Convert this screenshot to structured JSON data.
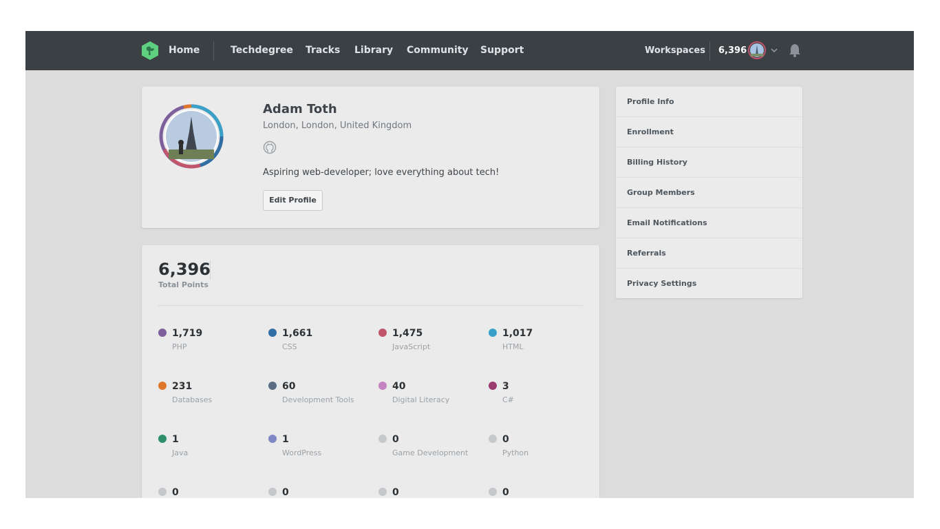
{
  "nav": {
    "home": "Home",
    "techdegree": "Techdegree",
    "tracks": "Tracks",
    "library": "Library",
    "community": "Community",
    "support": "Support",
    "workspaces": "Workspaces",
    "points": "6,396",
    "logo_icon": "treehouse-logo-icon",
    "bell_icon": "bell-icon",
    "chevron_icon": "chevron-down-icon"
  },
  "profile": {
    "name": "Adam Toth",
    "location": "London, London, United Kingdom",
    "github_icon": "github-icon",
    "bio": "Aspiring web-developer; love everything about tech!",
    "edit_button": "Edit Profile"
  },
  "points": {
    "total": "6,396",
    "total_label": "Total Points",
    "topics": [
      {
        "value": "1,719",
        "label": "PHP",
        "color": "#7d5f9c"
      },
      {
        "value": "1,661",
        "label": "CSS",
        "color": "#2f6fa3"
      },
      {
        "value": "1,475",
        "label": "JavaScript",
        "color": "#c0556b"
      },
      {
        "value": "1,017",
        "label": "HTML",
        "color": "#39a1c7"
      },
      {
        "value": "231",
        "label": "Databases",
        "color": "#e0762b"
      },
      {
        "value": "60",
        "label": "Development Tools",
        "color": "#5d6e82"
      },
      {
        "value": "40",
        "label": "Digital Literacy",
        "color": "#c484c4"
      },
      {
        "value": "3",
        "label": "C#",
        "color": "#9b3d6f"
      },
      {
        "value": "1",
        "label": "Java",
        "color": "#2f8f6d"
      },
      {
        "value": "1",
        "label": "WordPress",
        "color": "#7f87c4"
      },
      {
        "value": "0",
        "label": "Game Development",
        "color": "#c5c8cb"
      },
      {
        "value": "0",
        "label": "Python",
        "color": "#c5c8cb"
      },
      {
        "value": "0",
        "label": "",
        "color": "#c5c8cb"
      },
      {
        "value": "0",
        "label": "",
        "color": "#c5c8cb"
      },
      {
        "value": "0",
        "label": "",
        "color": "#c5c8cb"
      },
      {
        "value": "0",
        "label": "",
        "color": "#c5c8cb"
      }
    ]
  },
  "sidebar": {
    "items": [
      {
        "label": "Profile Info"
      },
      {
        "label": "Enrollment"
      },
      {
        "label": "Billing History"
      },
      {
        "label": "Group Members"
      },
      {
        "label": "Email Notifications"
      },
      {
        "label": "Referrals"
      },
      {
        "label": "Privacy Settings"
      }
    ]
  }
}
